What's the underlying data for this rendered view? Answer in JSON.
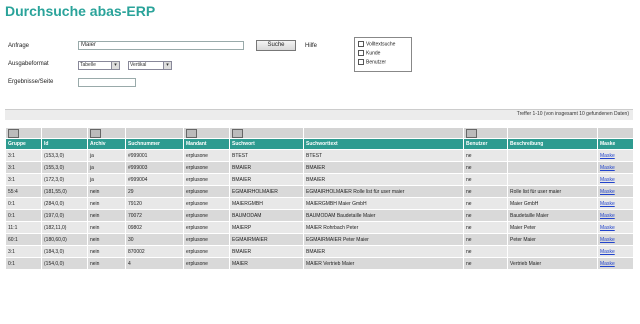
{
  "title": "Durchsuche abas-ERP",
  "form": {
    "anfrage_label": "Anfrage",
    "anfrage_value": "Maier",
    "suche_button": "Suche",
    "hilfe_link": "Hilfe",
    "ausgabeformat_label": "Ausgabeformat",
    "format_select": "Tabelle",
    "format_select2": "Vertikal",
    "ergebnisse_label": "Ergebnisse/Seite",
    "ergebnisse_value": ""
  },
  "options": [
    {
      "label": "Volltextsuche"
    },
    {
      "label": "Kunde"
    },
    {
      "label": "Benutzer"
    }
  ],
  "info": "Treffer 1-10 (von insgesamt 10 gefundenen Daten)",
  "table": {
    "headers": [
      "Gruppe",
      "Id",
      "Archiv",
      "Suchnummer",
      "Mandant",
      "Suchwort",
      "Suchworttext",
      "Benutzer",
      "Beschreibung",
      "Maske"
    ],
    "rows": [
      [
        "3:1",
        "(153,3,0)",
        "ja",
        "#999001",
        "erplusone",
        "BTEST",
        "BTEST",
        "ne",
        "",
        "Maske"
      ],
      [
        "3:1",
        "(155,3,0)",
        "ja",
        "#999003",
        "erplusone",
        "BMAIER",
        "BMAIER",
        "ne",
        "",
        "Maske"
      ],
      [
        "3:1",
        "(172,3,0)",
        "ja",
        "#999004",
        "erplusone",
        "BMAIER",
        "BMAIER",
        "ne",
        "",
        "Maske"
      ],
      [
        "55:4",
        "(181,55,0)",
        "nein",
        "29",
        "erplusone",
        "EGMAIRHOLMAIER",
        "EGMAIRHOLMAIER Rolle list für user maier",
        "ne",
        "Rolle list für user maier",
        "Maske"
      ],
      [
        "0:1",
        "(284,0,0)",
        "nein",
        "79120",
        "erplusone",
        "MAIERGMBH",
        "MAIERGMBH Maier GmbH",
        "ne",
        "Maier GmbH",
        "Maske"
      ],
      [
        "0:1",
        "(197,0,0)",
        "nein",
        "70072",
        "erplusone",
        "BAUMODAM",
        "BAUMODAM Baudetaille Maier",
        "ne",
        "Baudetaille Maier",
        "Maske"
      ],
      [
        "11:1",
        "(182,11,0)",
        "nein",
        "09802",
        "erplusone",
        "MAIERP",
        "MAIER Rohrbach Peter",
        "ne",
        "Maier Peter",
        "Maske"
      ],
      [
        "60:1",
        "(180,60,0)",
        "nein",
        "30",
        "erplusone",
        "EGMAIRMAIER",
        "EGMAIRMAIER Peter Maier",
        "ne",
        "Peter Maier",
        "Maske"
      ],
      [
        "3:1",
        "(184,3,0)",
        "nein",
        "870002",
        "erplusone",
        "BMAIER",
        "BMAIER",
        "ne",
        "",
        "Maske"
      ],
      [
        "0:1",
        "(154,0,0)",
        "nein",
        "4",
        "erplusone",
        "MAIER",
        "MAIER Vertrieb Maier",
        "ne",
        "Vertrieb Maier",
        "Maske"
      ]
    ]
  }
}
